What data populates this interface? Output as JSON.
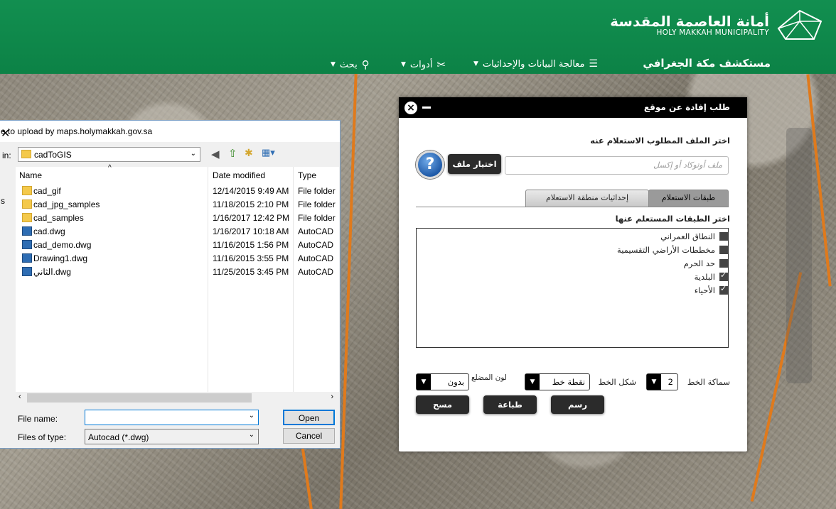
{
  "header": {
    "org_name_ar": "أمانة العاصمة المقدسة",
    "org_name_en": "HOLY MAKKAH MUNICIPALITY",
    "app_title": "مستكشف مكة الجغرافي",
    "nav": [
      {
        "label": "معالجة البيانات والإحداثيات",
        "icon": "database-icon"
      },
      {
        "label": "أدوات",
        "icon": "tools-icon"
      },
      {
        "label": "بحث",
        "icon": "search-icon"
      }
    ],
    "brand_color": "#0f8a4c"
  },
  "query_panel": {
    "title": "طلب إفادة عن موقع",
    "file_prompt": "اختر الملف المطلوب الاستعلام عنه",
    "file_placeholder": "ملف أوتوكاد أو إكسل",
    "choose_file_label": "اختيار ملف",
    "tabs": [
      "طبقات الاستعلام",
      "إحداثيات منطقة الاستعلام"
    ],
    "layers_prompt": "اختر الطبقات المستعلم عنها",
    "layers": [
      {
        "label": "النطاق العمراني",
        "checked": false
      },
      {
        "label": "مخططات الأراضي التقسيمية",
        "checked": false
      },
      {
        "label": "حد الحرم",
        "checked": false
      },
      {
        "label": "البلدية",
        "checked": true
      },
      {
        "label": "الأحياء",
        "checked": true
      }
    ],
    "line_width_label": "سماكة الخط",
    "line_width_value": "2",
    "line_style_label": "شكل الخط",
    "line_style_value": "نقطة خط",
    "fill_color_label": "لون المضلع",
    "fill_color_value": "بدون",
    "draw_label": "رسم",
    "print_label": "طباعة",
    "clear_label": "مسح"
  },
  "file_dialog": {
    "title": "e to upload by maps.holymakkah.gov.sa",
    "look_in_label": "in:",
    "look_in_value": "cadToGIS",
    "left_edge_label": "s",
    "columns": [
      "Name",
      "Date modified",
      "Type"
    ],
    "files": [
      {
        "name": "cad_gif",
        "date": "12/14/2015 9:49 AM",
        "type": "File folder",
        "kind": "folder"
      },
      {
        "name": "cad_jpg_samples",
        "date": "11/18/2015 2:10 PM",
        "type": "File folder",
        "kind": "folder"
      },
      {
        "name": "cad_samples",
        "date": "1/16/2017 12:42 PM",
        "type": "File folder",
        "kind": "folder"
      },
      {
        "name": "cad.dwg",
        "date": "1/16/2017 10:18 AM",
        "type": "AutoCAD",
        "kind": "dwg"
      },
      {
        "name": "cad_demo.dwg",
        "date": "11/16/2015 1:56 PM",
        "type": "AutoCAD",
        "kind": "dwg"
      },
      {
        "name": "Drawing1.dwg",
        "date": "11/16/2015 3:55 PM",
        "type": "AutoCAD",
        "kind": "dwg"
      },
      {
        "name": "الثاني.dwg",
        "date": "11/25/2015 3:45 PM",
        "type": "AutoCAD",
        "kind": "dwg"
      }
    ],
    "file_name_label": "File name:",
    "file_name_value": "",
    "files_of_type_label": "Files of type:",
    "files_of_type_value": "Autocad (*.dwg)",
    "open_label": "Open",
    "cancel_label": "Cancel"
  }
}
